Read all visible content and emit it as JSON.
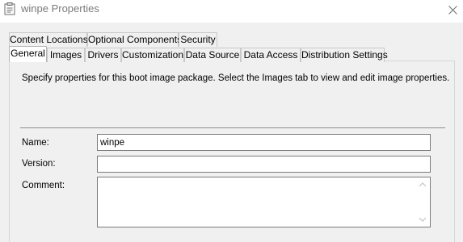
{
  "window": {
    "title": "winpe Properties",
    "icon": "properties-document-icon",
    "close_icon": "close-icon"
  },
  "tabs": {
    "row_top": [
      "Content Locations",
      "Optional Components",
      "Security"
    ],
    "row_bottom": [
      "General",
      "Images",
      "Drivers",
      "Customization",
      "Data Source",
      "Data Access",
      "Distribution Settings"
    ],
    "active": "General"
  },
  "general": {
    "description": "Specify properties for this boot image package. Select the Images tab to view and edit image properties.",
    "name_label": "Name:",
    "name_value": "winpe",
    "version_label": "Version:",
    "version_value": "",
    "comment_label": "Comment:",
    "comment_value": ""
  }
}
